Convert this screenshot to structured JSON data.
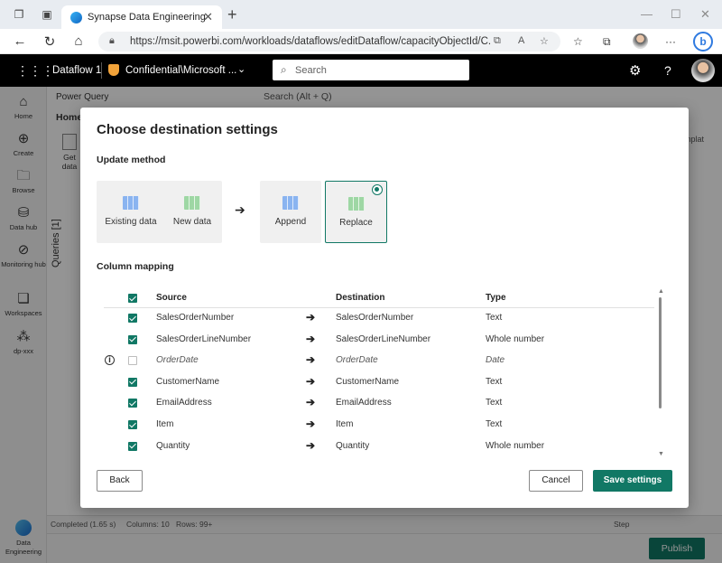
{
  "browser": {
    "tab_title": "Synapse Data Engineering",
    "url": "https://msit.powerbi.com/workloads/dataflows/editDataflow/capacityObjectId/C...",
    "bing_label": "b"
  },
  "appbar": {
    "item_name": "Dataflow 1",
    "sensitivity": "Confidential\\Microsoft ...",
    "search_placeholder": "Search"
  },
  "rail": {
    "items": [
      {
        "label": "Home"
      },
      {
        "label": "Create"
      },
      {
        "label": "Browse"
      },
      {
        "label": "Data hub"
      },
      {
        "label": "Monitoring hub"
      },
      {
        "label": "Workspaces"
      },
      {
        "label": "dp-xxx"
      }
    ],
    "experience": "Data Engineering"
  },
  "background": {
    "pane_title": "Power Query",
    "search": "Search (Alt + Q)",
    "home_tab": "Home",
    "get_data": "Get data",
    "queries": "Queries [1]",
    "status_completed": "Completed (1.65 s)",
    "status_columns": "Columns: 10",
    "status_rows": "Rows: 99+",
    "step": "Step",
    "publish": "Publish",
    "right_text": "mplat"
  },
  "dialog": {
    "title": "Choose destination settings",
    "update_method_label": "Update method",
    "existing_data": "Existing data",
    "new_data": "New data",
    "append": "Append",
    "replace": "Replace",
    "column_mapping_label": "Column mapping",
    "headers": {
      "source": "Source",
      "destination": "Destination",
      "type": "Type"
    },
    "rows": [
      {
        "source": "SalesOrderNumber",
        "destination": "SalesOrderNumber",
        "type": "Text",
        "checked": true
      },
      {
        "source": "SalesOrderLineNumber",
        "destination": "SalesOrderLineNumber",
        "type": "Whole number",
        "checked": true
      },
      {
        "source": "OrderDate",
        "destination": "OrderDate",
        "type": "Date",
        "checked": false
      },
      {
        "source": "CustomerName",
        "destination": "CustomerName",
        "type": "Text",
        "checked": true
      },
      {
        "source": "EmailAddress",
        "destination": "EmailAddress",
        "type": "Text",
        "checked": true
      },
      {
        "source": "Item",
        "destination": "Item",
        "type": "Text",
        "checked": true
      },
      {
        "source": "Quantity",
        "destination": "Quantity",
        "type": "Whole number",
        "checked": true
      }
    ],
    "back": "Back",
    "cancel": "Cancel",
    "save": "Save settings"
  },
  "colors": {
    "accent": "#117865"
  }
}
